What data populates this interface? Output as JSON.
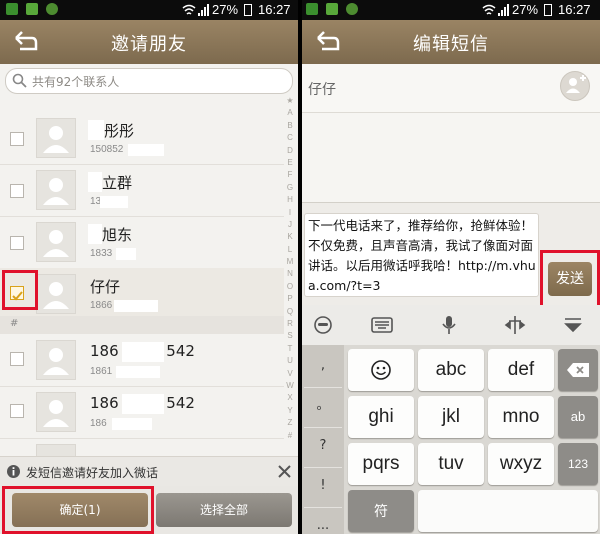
{
  "status_bar": {
    "battery": "27%",
    "time": "16:27"
  },
  "invite": {
    "title": "邀请朋友",
    "search_placeholder": "共有92个联系人",
    "contacts": [
      {
        "name": "彤彤",
        "number": "150852",
        "checked": false
      },
      {
        "name": "立群",
        "number": "13     972",
        "checked": false
      },
      {
        "name": "旭东",
        "number": "1833",
        "checked": false
      },
      {
        "name": "仔仔",
        "number": "1866",
        "checked": true
      },
      {
        "name": "186          542",
        "number": "1861",
        "checked": false
      },
      {
        "name": "186          542",
        "number": "186          42",
        "checked": false
      }
    ],
    "section_letter": "#",
    "index_letters": [
      "A",
      "B",
      "C",
      "D",
      "E",
      "F",
      "G",
      "H",
      "I",
      "J",
      "K",
      "L",
      "M",
      "N",
      "O",
      "P",
      "Q",
      "R",
      "S",
      "T",
      "U",
      "V",
      "W",
      "X",
      "Y",
      "Z",
      "#"
    ],
    "info_text": "发短信邀请好友加入微话",
    "confirm_label": "确定(1)",
    "select_all_label": "选择全部"
  },
  "sms": {
    "title": "编辑短信",
    "recipient": "仔仔",
    "message": "下一代电话来了，推荐给你，抢鲜体验！不仅免费，且声音高清，我试了像面对面讲话。以后用微话呼我哈！http://m.vhua.com/?t=3",
    "send_label": "发送",
    "left_keys": [
      ",",
      "。",
      "?",
      "!",
      "..."
    ],
    "keys": [
      "abc",
      "def",
      "ghi",
      "jkl",
      "mno",
      "pqrs",
      "tuv",
      "wxyz"
    ],
    "symbol_key": "符",
    "ab_key": "ab",
    "num_key": "123"
  },
  "colors": {
    "accent": "#8b7657",
    "highlight": "#e0112b",
    "checked": "#d9a21a"
  }
}
